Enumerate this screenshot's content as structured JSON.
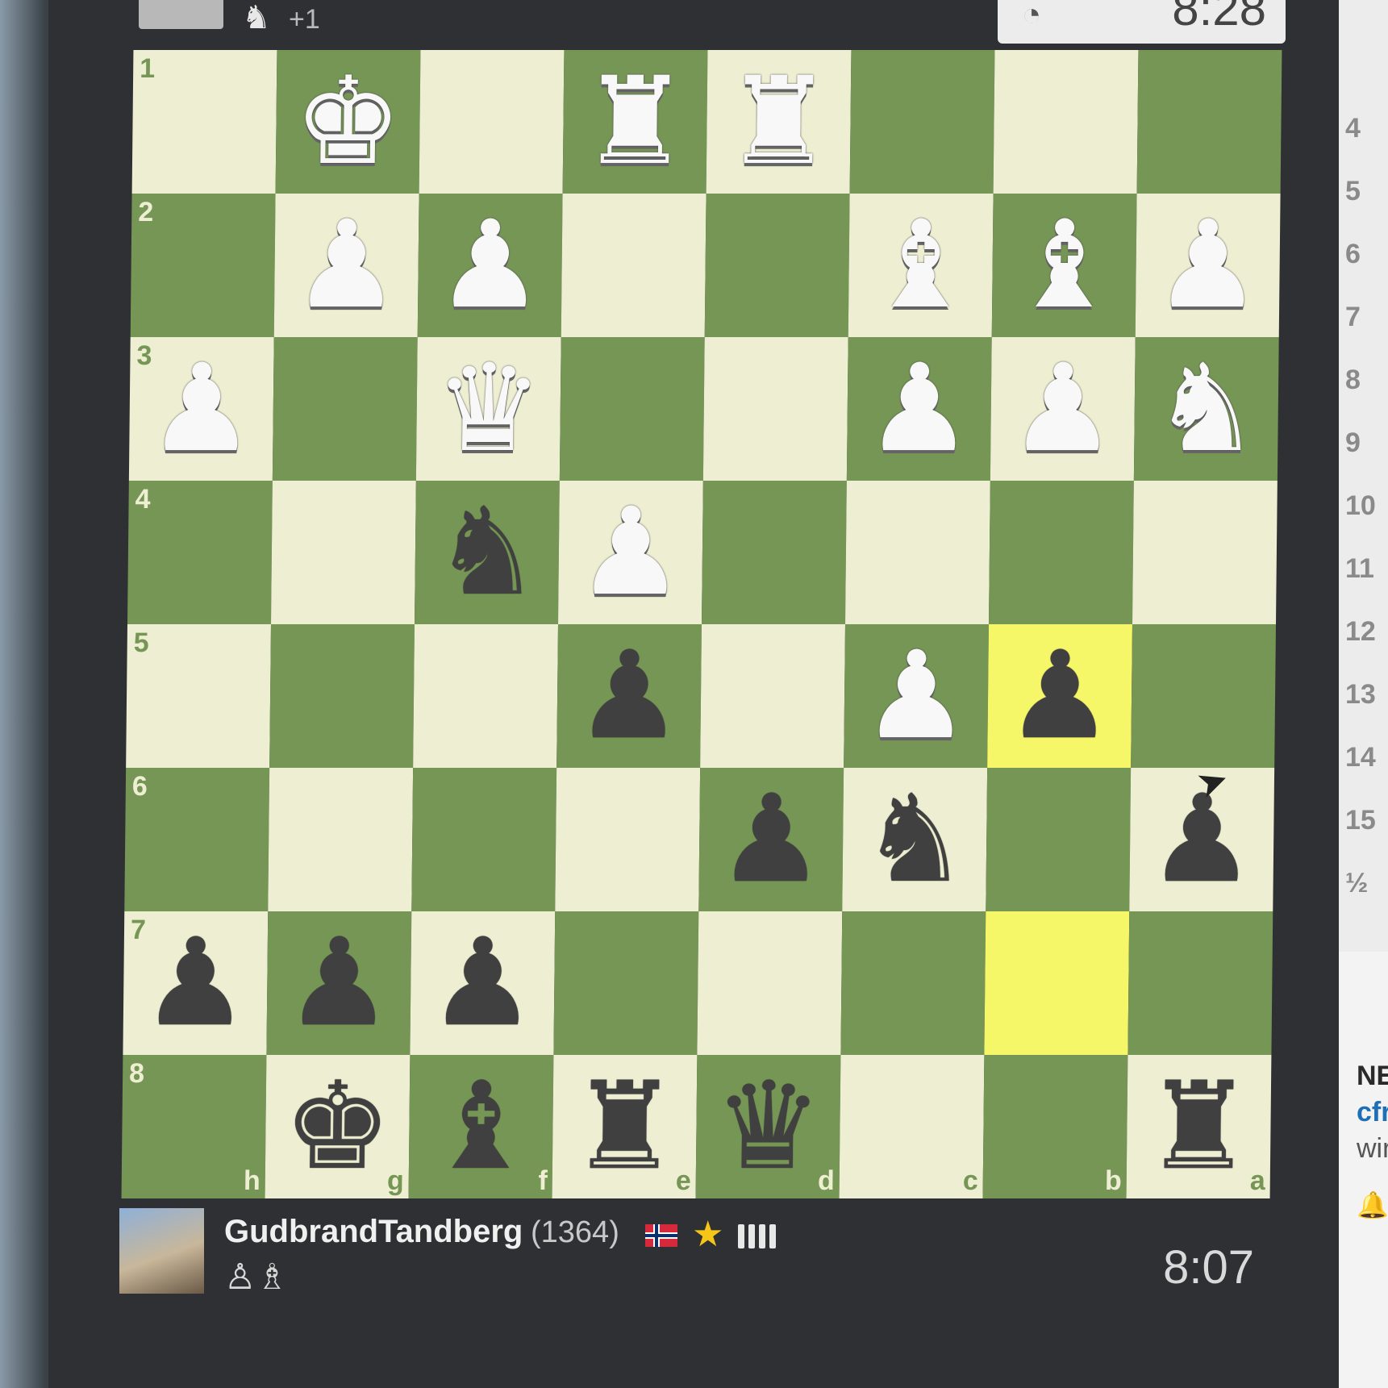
{
  "opponent": {
    "captured": "♞",
    "advantage": "+1",
    "clock": "8:28"
  },
  "board": {
    "rows": [
      {
        "rank": "1",
        "squares": [
          {
            "piece": "",
            "color": ""
          },
          {
            "piece": "♚",
            "color": "white"
          },
          {
            "piece": "",
            "color": ""
          },
          {
            "piece": "♜",
            "color": "white"
          },
          {
            "piece": "♜",
            "color": "white"
          },
          {
            "piece": "",
            "color": ""
          },
          {
            "piece": "",
            "color": ""
          },
          {
            "piece": "",
            "color": ""
          }
        ]
      },
      {
        "rank": "2",
        "squares": [
          {
            "piece": "",
            "color": ""
          },
          {
            "piece": "♟",
            "color": "white"
          },
          {
            "piece": "♟",
            "color": "white"
          },
          {
            "piece": "",
            "color": ""
          },
          {
            "piece": "",
            "color": ""
          },
          {
            "piece": "♝",
            "color": "white"
          },
          {
            "piece": "♝",
            "color": "white"
          },
          {
            "piece": "♟",
            "color": "white"
          }
        ]
      },
      {
        "rank": "3",
        "squares": [
          {
            "piece": "♟",
            "color": "white"
          },
          {
            "piece": "",
            "color": ""
          },
          {
            "piece": "♛",
            "color": "white"
          },
          {
            "piece": "",
            "color": ""
          },
          {
            "piece": "",
            "color": ""
          },
          {
            "piece": "♟",
            "color": "white"
          },
          {
            "piece": "♟",
            "color": "white"
          },
          {
            "piece": "♞",
            "color": "white"
          }
        ]
      },
      {
        "rank": "4",
        "squares": [
          {
            "piece": "",
            "color": ""
          },
          {
            "piece": "",
            "color": ""
          },
          {
            "piece": "♞",
            "color": "black"
          },
          {
            "piece": "♟",
            "color": "white"
          },
          {
            "piece": "",
            "color": ""
          },
          {
            "piece": "",
            "color": ""
          },
          {
            "piece": "",
            "color": ""
          },
          {
            "piece": "",
            "color": ""
          }
        ]
      },
      {
        "rank": "5",
        "squares": [
          {
            "piece": "",
            "color": ""
          },
          {
            "piece": "",
            "color": ""
          },
          {
            "piece": "",
            "color": ""
          },
          {
            "piece": "♟",
            "color": "black"
          },
          {
            "piece": "",
            "color": ""
          },
          {
            "piece": "♟",
            "color": "white"
          },
          {
            "piece": "♟",
            "color": "black"
          },
          {
            "piece": "",
            "color": ""
          }
        ]
      },
      {
        "rank": "6",
        "squares": [
          {
            "piece": "",
            "color": ""
          },
          {
            "piece": "",
            "color": ""
          },
          {
            "piece": "",
            "color": ""
          },
          {
            "piece": "",
            "color": ""
          },
          {
            "piece": "♟",
            "color": "black"
          },
          {
            "piece": "♞",
            "color": "black"
          },
          {
            "piece": "",
            "color": ""
          },
          {
            "piece": "♟",
            "color": "black"
          }
        ]
      },
      {
        "rank": "7",
        "squares": [
          {
            "piece": "♟",
            "color": "black"
          },
          {
            "piece": "♟",
            "color": "black"
          },
          {
            "piece": "♟",
            "color": "black"
          },
          {
            "piece": "",
            "color": ""
          },
          {
            "piece": "",
            "color": ""
          },
          {
            "piece": "",
            "color": ""
          },
          {
            "piece": "",
            "color": ""
          },
          {
            "piece": "",
            "color": ""
          }
        ]
      },
      {
        "rank": "8",
        "squares": [
          {
            "piece": "",
            "color": ""
          },
          {
            "piece": "♚",
            "color": "black"
          },
          {
            "piece": "♝",
            "color": "black"
          },
          {
            "piece": "♜",
            "color": "black"
          },
          {
            "piece": "♛",
            "color": "black"
          },
          {
            "piece": "",
            "color": ""
          },
          {
            "piece": "",
            "color": ""
          },
          {
            "piece": "♜",
            "color": "black"
          }
        ]
      }
    ],
    "files": [
      "h",
      "g",
      "f",
      "e",
      "d",
      "c",
      "b",
      "a"
    ],
    "highlight_squares": [
      "b5",
      "b7"
    ],
    "light_color": "#eeeed2",
    "dark_color": "#769656"
  },
  "player": {
    "name": "GudbrandTandberg",
    "rating": "(1364)",
    "flag": "norway-flag",
    "captured": "♙♗",
    "clock": "8:07"
  },
  "side_panel": {
    "move_numbers": [
      "4",
      "5",
      "6",
      "7",
      "8",
      "9",
      "10",
      "11",
      "12",
      "13",
      "14",
      "15",
      "½"
    ],
    "news_title": "NE",
    "news_link": "cfr",
    "news_sub": "wir"
  }
}
